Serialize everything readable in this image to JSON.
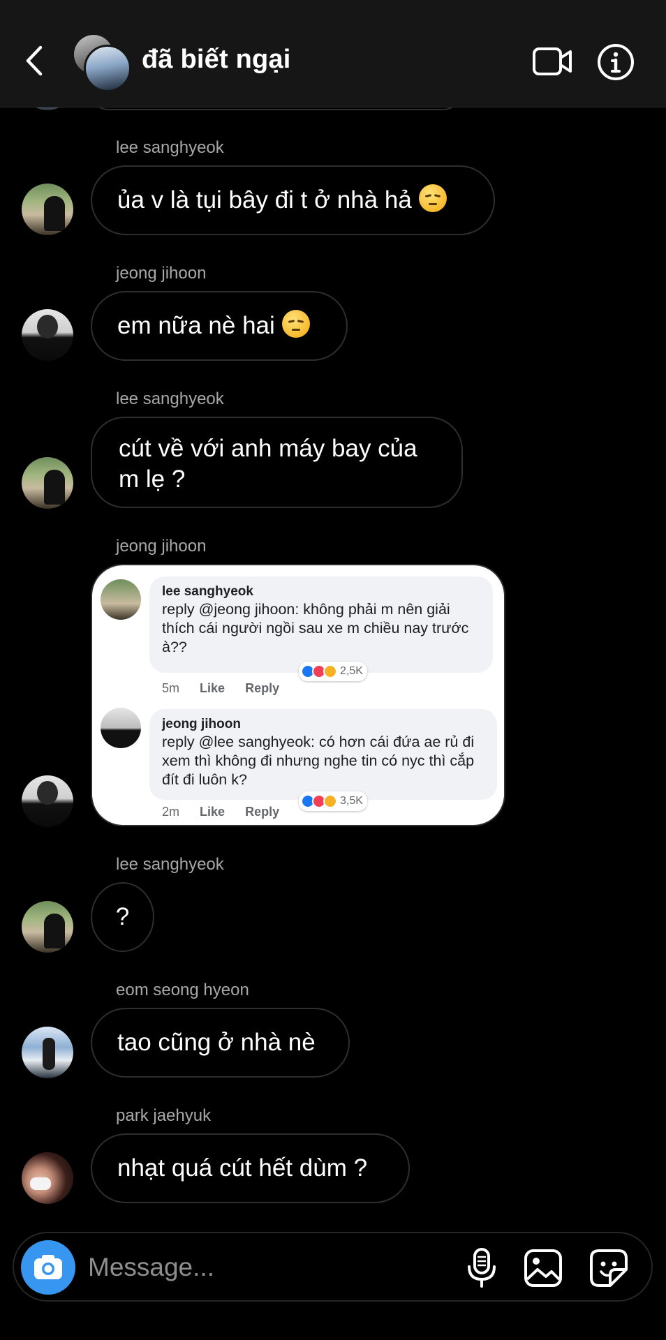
{
  "header": {
    "title": "đã biết ngại"
  },
  "messages": [
    {
      "sender": "lee sanghyeok",
      "text": "ủa v là tụi bây đi t ở nhà hả",
      "emoji": "pensive-face"
    },
    {
      "sender": "jeong jihoon",
      "text": "em nữa nè hai",
      "emoji": "pensive-face"
    },
    {
      "sender": "lee sanghyeok",
      "text": "cút về với anh máy bay của m lẹ ?"
    },
    {
      "sender": "jeong jihoon",
      "shared_image": true
    },
    {
      "sender": "lee sanghyeok",
      "text": "?"
    },
    {
      "sender": "eom seong hyeon",
      "text": "tao cũng ở nhà nè"
    },
    {
      "sender": "park jaehyuk",
      "text": "nhạt quá cút hết dùm ?"
    }
  ],
  "shared_screenshot": {
    "comments": [
      {
        "name": "lee sanghyeok",
        "text": "reply @jeong jihoon: không phải m nên giải thích cái người ngồi sau xe m chiều nay trước à??",
        "time": "5m",
        "like_label": "Like",
        "reply_label": "Reply",
        "reactions": "2,5K"
      },
      {
        "name": "jeong jihoon",
        "text": "reply @lee sanghyeok: có hơn cái đứa ae rủ đi xem thì không đi nhưng nghe tin có nyc thì cắp đít đi luôn k?",
        "time": "2m",
        "like_label": "Like",
        "reply_label": "Reply",
        "reactions": "3,5K"
      }
    ]
  },
  "composer": {
    "placeholder": "Message..."
  },
  "colors": {
    "background": "#000000",
    "header": "#161616",
    "bubble_border": "#2e2e2e",
    "camera_button": "#3797f0",
    "sender_text": "#a8a8a8"
  }
}
